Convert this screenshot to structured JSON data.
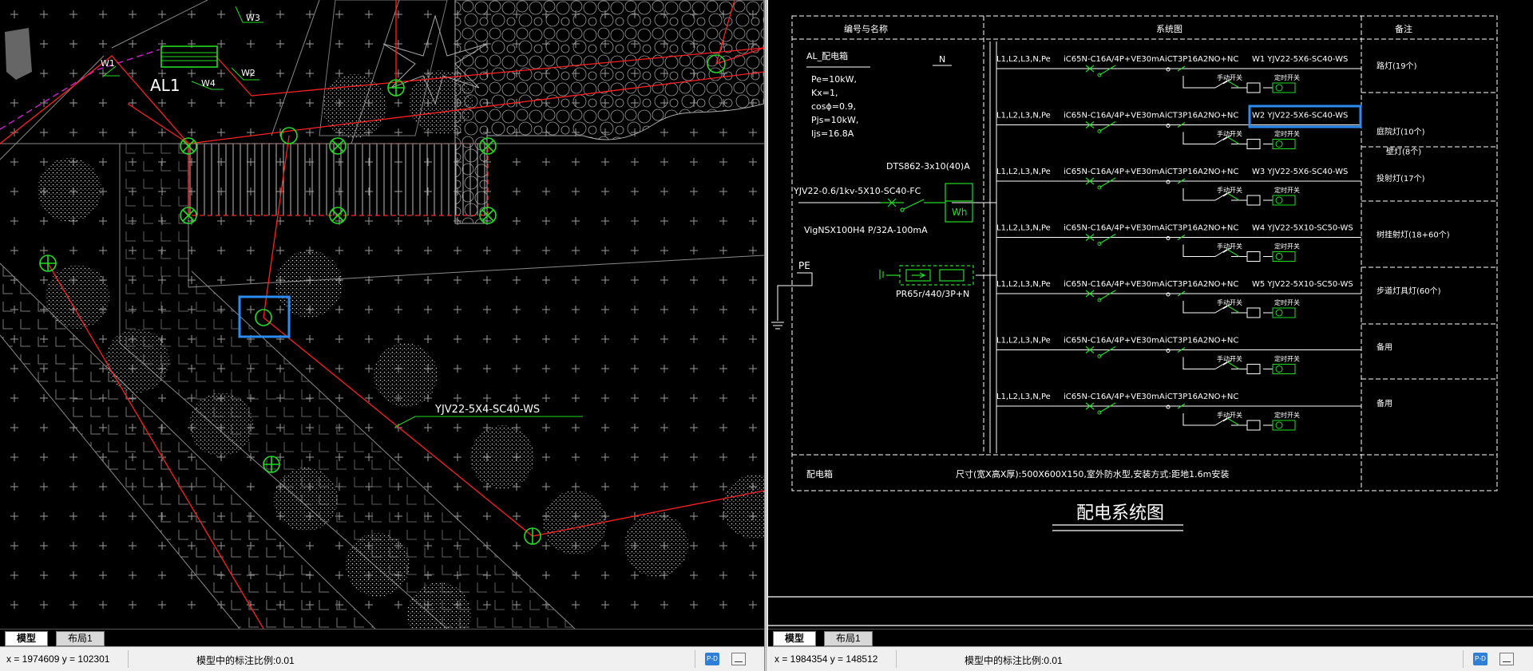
{
  "left_view": {
    "labels": {
      "w3": "W3",
      "w1": "W1",
      "w2": "W2",
      "w4": "W4",
      "panel": "AL1",
      "cable": "YJV22-5X4-SC40-WS"
    },
    "tabs": [
      "模型",
      "布局1"
    ],
    "status": {
      "coords": "x = 1974609  y = 102301",
      "scale": "模型中的标注比例:0.01",
      "button": "P-D"
    }
  },
  "right_view": {
    "header": {
      "col1": "编号与名称",
      "col2": "系统图",
      "col3": "备注"
    },
    "panel": {
      "name": "AL_配电箱",
      "neutral": "N",
      "params": [
        "Pe=10kW,",
        "Kx=1,",
        "cosϕ=0.9,",
        "Pjs=10kW,",
        "Ijs=16.8A"
      ],
      "meter": "DTS862-3x10(40)A",
      "meter_label": "Wh",
      "incoming": "YJV22-0.6/1kv-5X10-SC40-FC",
      "main_breaker": "VigNSX100H4 P/32A-100mA",
      "pe": "PE",
      "spd": "PR65r/440/3P+N"
    },
    "circuits": [
      {
        "phase": "L1,L2,L3,N,Pe",
        "breaker": "iC65N-C16A/4P+VE30mA",
        "contactor": "iCT3P16A2NO+NC",
        "cable": "W1  YJV22-5X6-SC40-WS",
        "hand": "手动开关",
        "timer": "定时开关",
        "note": "路灯(19个)"
      },
      {
        "phase": "L1,L2,L3,N,Pe",
        "breaker": "iC65N-C16A/4P+VE30mA",
        "contactor": "iCT3P16A2NO+NC",
        "cable": "W2  YJV22-5X6-SC40-WS",
        "hand": "手动开关",
        "timer": "定时开关",
        "note": "庭院灯(10个)",
        "note2": "壁灯(8个)"
      },
      {
        "phase": "L1,L2,L3,N,Pe",
        "breaker": "iC65N-C16A/4P+VE30mA",
        "contactor": "iCT3P16A2NO+NC",
        "cable": "W3  YJV22-5X6-SC40-WS",
        "hand": "手动开关",
        "timer": "定时开关",
        "note": "投射灯(17个)"
      },
      {
        "phase": "L1,L2,L3,N,Pe",
        "breaker": "iC65N-C16A/4P+VE30mA",
        "contactor": "iCT3P16A2NO+NC",
        "cable": "W4  YJV22-5X10-SC50-WS",
        "hand": "手动开关",
        "timer": "定时开关",
        "note": "树挂射灯(18+60个)"
      },
      {
        "phase": "L1,L2,L3,N,Pe",
        "breaker": "iC65N-C16A/4P+VE30mA",
        "contactor": "iCT3P16A2NO+NC",
        "cable": "W5  YJV22-5X10-SC50-WS",
        "hand": "手动开关",
        "timer": "定时开关",
        "note": "步道灯具灯(60个)"
      },
      {
        "phase": "L1,L2,L3,N,Pe",
        "breaker": "iC65N-C16A/4P+VE30mA",
        "contactor": "iCT3P16A2NO+NC",
        "cable": "",
        "hand": "手动开关",
        "timer": "定时开关",
        "note": "备用"
      },
      {
        "phase": "L1,L2,L3,N,Pe",
        "breaker": "iC65N-C16A/4P+VE30mA",
        "contactor": "iCT3P16A2NO+NC",
        "cable": "",
        "hand": "手动开关",
        "timer": "定时开关",
        "note": "备用"
      }
    ],
    "footer": {
      "left": "配电箱",
      "spec": "尺寸(宽X高X厚):500X600X150,室外防水型,安装方式:距地1.6m安装"
    },
    "title": "配电系统图",
    "tabs": [
      "模型",
      "布局1"
    ],
    "status": {
      "coords": "x = 1984354  y = 148512",
      "scale": "模型中的标注比例:0.01",
      "button": "P-D"
    }
  },
  "colors": {
    "background": "#000000",
    "cad_red": "#ff2020",
    "cad_green": "#22dd22",
    "cad_white": "#ffffff",
    "cad_magenta": "#d020d0",
    "selection_blue": "#2d8cf0"
  }
}
